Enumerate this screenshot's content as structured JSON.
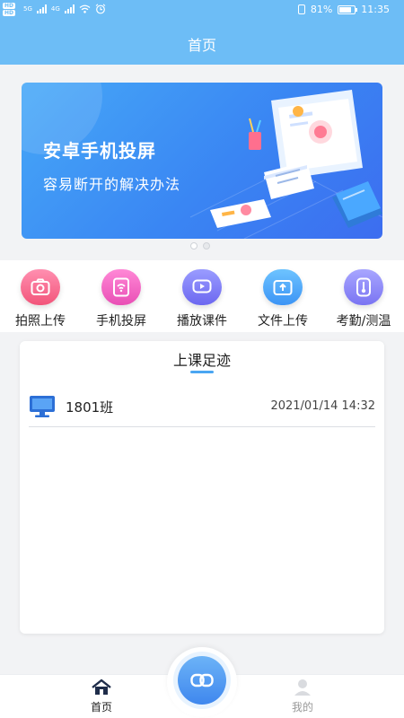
{
  "status_bar": {
    "badges": [
      "HD",
      "HD"
    ],
    "network_1": "5G",
    "network_2": "4G",
    "battery": "81%",
    "battery_level": 0.81,
    "time": "11:35"
  },
  "header": {
    "title": "首页"
  },
  "banner": {
    "title": "安卓手机投屏",
    "subtitle": "容易断开的解决办法",
    "page_count": 2,
    "active_page": 2
  },
  "features": [
    {
      "label": "拍照上传",
      "icon": "camera-icon",
      "color_from": "#ff8fb0",
      "color_to": "#f2557a"
    },
    {
      "label": "手机投屏",
      "icon": "phone-cast-icon",
      "color_from": "#ff88d6",
      "color_to": "#e94fb5"
    },
    {
      "label": "播放课件",
      "icon": "play-video-icon",
      "color_from": "#9a9cff",
      "color_to": "#6c67f0"
    },
    {
      "label": "文件上传",
      "icon": "upload-icon",
      "color_from": "#6dc3ff",
      "color_to": "#3c94f5"
    },
    {
      "label": "考勤/测温",
      "icon": "thermometer-icon",
      "color_from": "#a8a6ff",
      "color_to": "#7a74f2"
    }
  ],
  "footprints": {
    "title": "上课足迹",
    "records": [
      {
        "class_name": "1801班",
        "time": "2021/01/14 14:32",
        "icon": "monitor-icon"
      }
    ]
  },
  "tabbar": {
    "home_label": "首页",
    "me_label": "我的",
    "center_icon": "link-icon"
  },
  "colors": {
    "header": "#6dbdf6",
    "accent": "#3f87ee",
    "background": "#f2f3f5"
  }
}
